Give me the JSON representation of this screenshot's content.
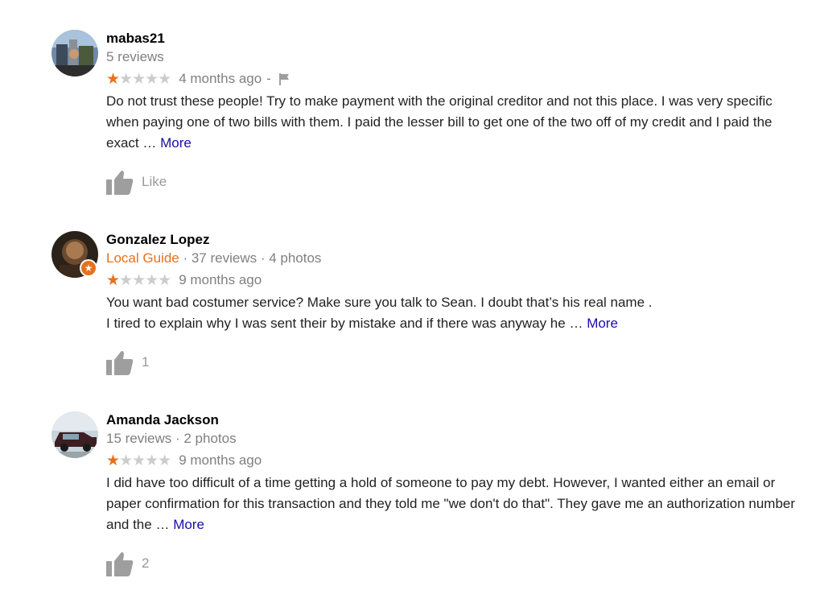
{
  "colors": {
    "accent": "#e7711b",
    "link": "#1a0dab",
    "muted": "#808080",
    "star_off": "#cccccc",
    "thumb": "#999999"
  },
  "reviews": [
    {
      "name": "mabas21",
      "local_guide": "",
      "meta": "5 reviews",
      "rating": 1,
      "stars_display": {
        "on": "★",
        "off": "★★★★"
      },
      "time": "4 months ago",
      "flag_separator": "-",
      "text": "Do not trust these people! Try to make payment with the original creditor and not this place. I was very specific when paying one of two bills with them. I paid the lesser bill to get one of the two off of my credit and I paid the exact …",
      "more_label": "More",
      "like_label": "Like",
      "avatar_icon": "user-photo-icon"
    },
    {
      "name": "Gonzalez Lopez",
      "local_guide": "Local Guide",
      "meta": " · 37 reviews · 4 photos",
      "rating": 1,
      "stars_display": {
        "on": "★",
        "off": "★★★★"
      },
      "time": "9 months ago",
      "text_line1": "You want bad costumer service? Make sure you talk to Sean. I doubt that’s his real name .",
      "text_line2": "I tired to explain why I was sent their by mistake and if there was anyway he …",
      "more_label": "More",
      "like_label": "1",
      "avatar_icon": "user-photo-icon",
      "badge_icon": "local-guide-star-icon"
    },
    {
      "name": "Amanda Jackson",
      "local_guide": "",
      "meta": "15 reviews · 2 photos",
      "rating": 1,
      "stars_display": {
        "on": "★",
        "off": "★★★★"
      },
      "time": "9 months ago",
      "text": "I did have too difficult of a time getting a hold of someone to pay my debt.  However, I wanted either an email or paper confirmation for this transaction and they told me \"we don't do that\". They gave me an authorization number and the …",
      "more_label": "More",
      "like_label": "2",
      "avatar_icon": "car-photo-icon"
    }
  ]
}
